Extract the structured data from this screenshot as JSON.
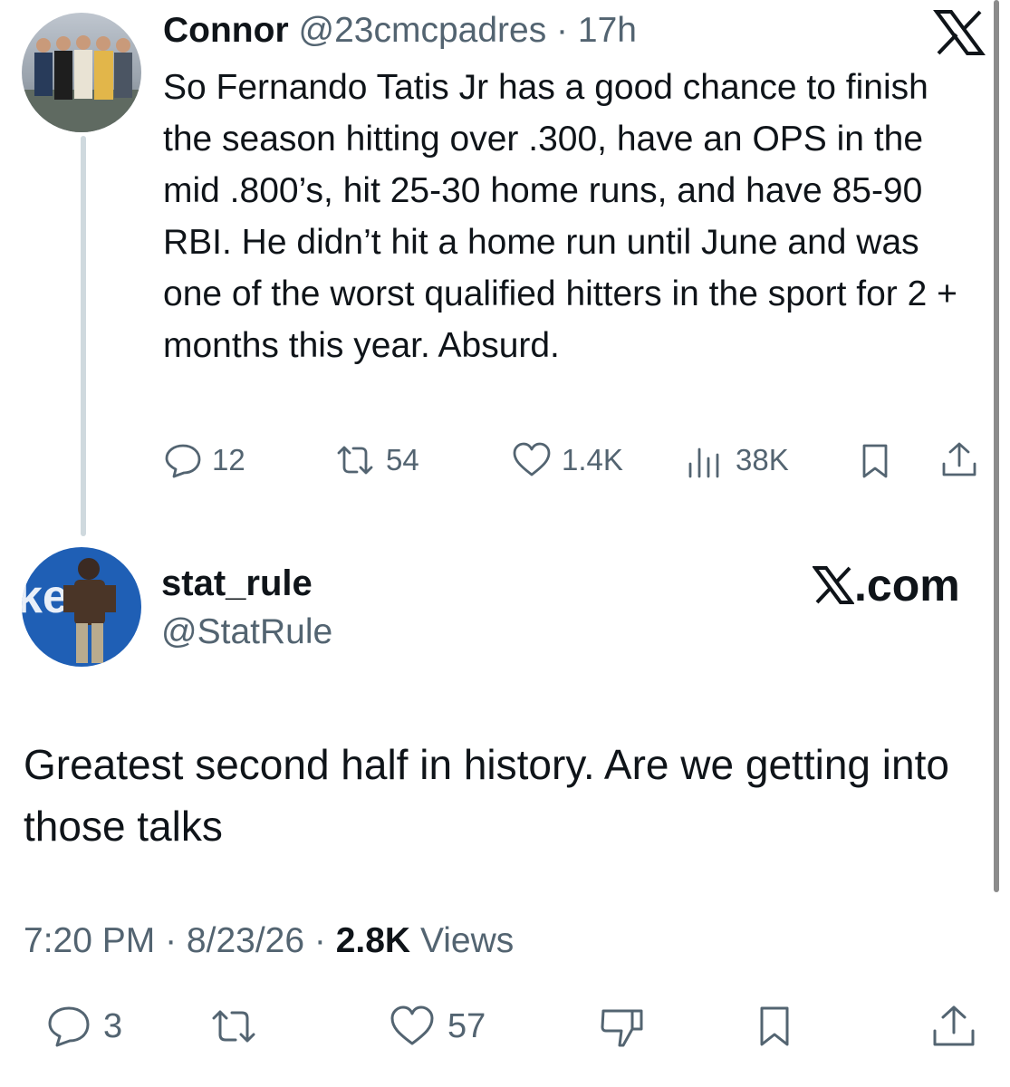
{
  "quoted_tweet": {
    "author_name": "Connor",
    "author_handle": "@23cmcpadres",
    "separator": "·",
    "time_ago": "17h",
    "text": "So Fernando Tatis Jr has a good chance to finish the season hitting over .300, have an OPS in the mid .800’s, hit 25-30 home runs, and have 85-90 RBI. He didn’t hit a home run until June and was one of the worst qualified hitters in the sport for 2 + months this year. Absurd.",
    "replies": "12",
    "reposts": "54",
    "likes": "1.4K",
    "views": "38K"
  },
  "main_tweet": {
    "author_name": "stat_rule",
    "author_handle": "@StatRule",
    "brand_text": ".com",
    "text": "Greatest second half in history. Are we getting into those talks",
    "time": "7:20 PM",
    "date": "8/23/26",
    "views_count": "2.8K",
    "views_label": "Views",
    "replies": "3",
    "likes": "57"
  },
  "icons": [
    "x-logo-icon",
    "reply-icon",
    "repost-icon",
    "like-icon",
    "views-icon",
    "bookmark-icon",
    "share-icon",
    "dislike-icon"
  ],
  "colors": {
    "text": "#0f1419",
    "secondary": "#536471",
    "thread_line": "#cfd9de",
    "avatar_blue": "#1f5fb5"
  }
}
